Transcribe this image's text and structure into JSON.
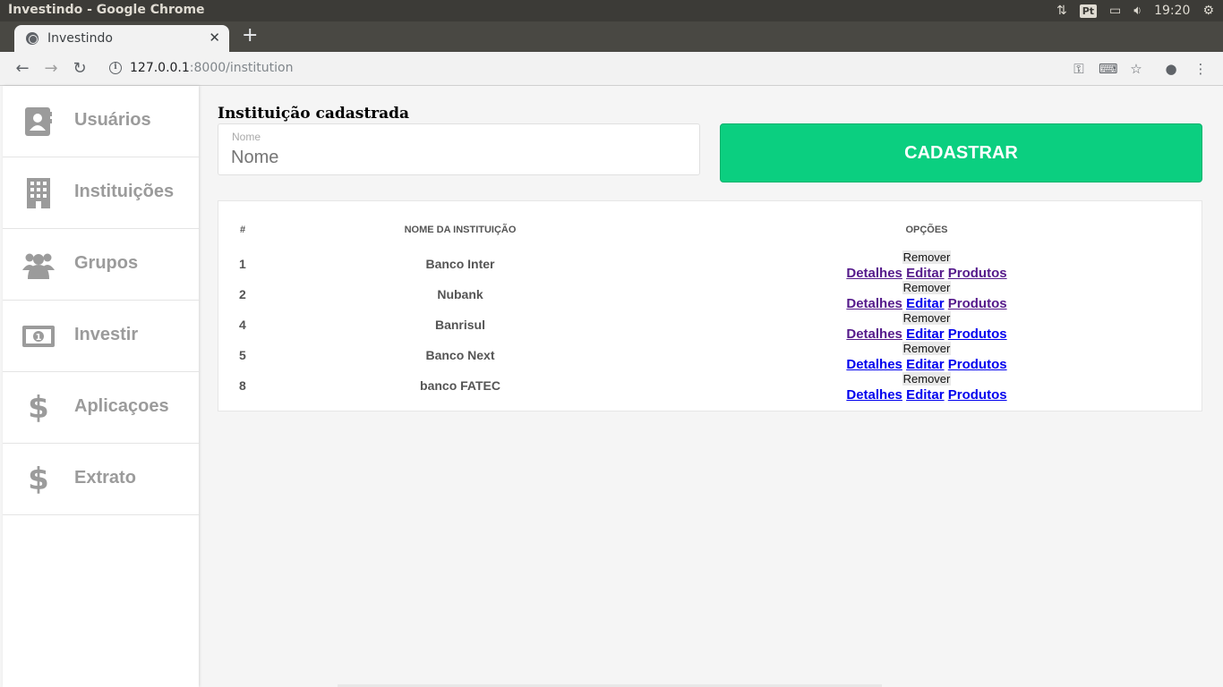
{
  "os": {
    "window_title": "Investindo - Google Chrome",
    "keyboard_layout": "Pt",
    "clock": "19:20"
  },
  "browser": {
    "tab_title": "Investindo",
    "url_host": "127.0.0.1",
    "url_rest": ":8000/institution"
  },
  "sidebar": {
    "items": [
      {
        "label": "Usuários",
        "icon": "contacts-book-icon"
      },
      {
        "label": "Instituições",
        "icon": "building-icon"
      },
      {
        "label": "Grupos",
        "icon": "users-group-icon"
      },
      {
        "label": "Investir",
        "icon": "money-bill-icon"
      },
      {
        "label": "Aplicaçoes",
        "icon": "dollar-icon"
      },
      {
        "label": "Extrato",
        "icon": "dollar-icon"
      }
    ]
  },
  "form": {
    "title": "Instituição cadastrada",
    "name_label": "Nome",
    "name_placeholder": "Nome",
    "submit_label": "CADASTRAR"
  },
  "table": {
    "headers": {
      "id": "#",
      "name": "NOME DA INSTITUIÇÃO",
      "options": "OPÇÕES"
    },
    "rows": [
      {
        "id": "1",
        "name": "Banco Inter"
      },
      {
        "id": "2",
        "name": "Nubank"
      },
      {
        "id": "4",
        "name": "Banrisul"
      },
      {
        "id": "5",
        "name": "Banco Next"
      },
      {
        "id": "8",
        "name": "banco FATEC"
      }
    ],
    "actions": {
      "remove": "Remover",
      "details": "Detalhes",
      "edit": "Editar",
      "products": "Produtos"
    }
  },
  "colors": {
    "accent": "#0bcf80",
    "sidebar_text": "#9b9b9b",
    "link": "#0000ee",
    "link_visited": "#551a8b"
  }
}
